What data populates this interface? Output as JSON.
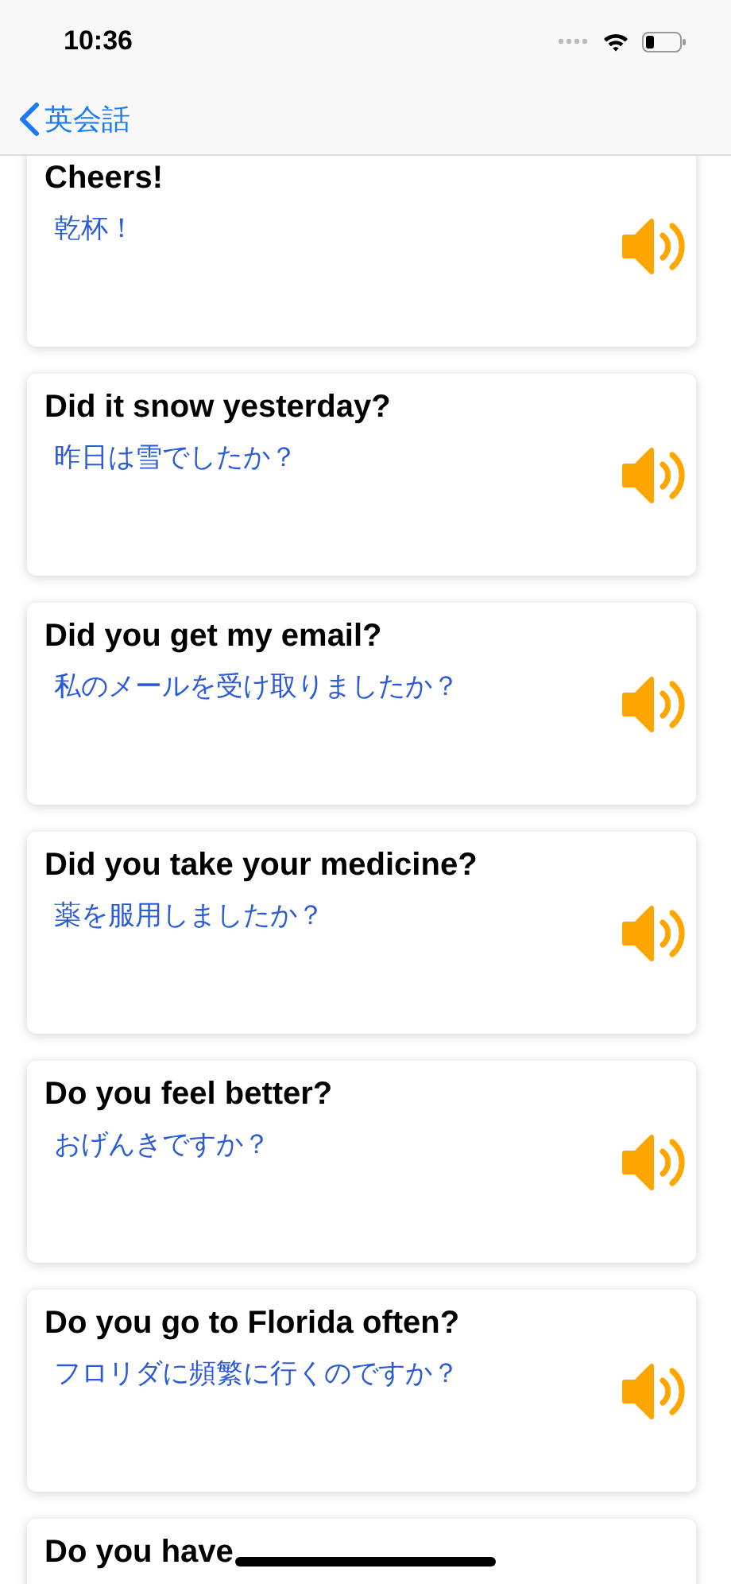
{
  "status_bar": {
    "time": "10:36"
  },
  "nav": {
    "back_label": "英会話"
  },
  "cards": [
    {
      "english": "Cheers!",
      "japanese": "乾杯！"
    },
    {
      "english": "Did it snow yesterday?",
      "japanese": "昨日は雪でしたか？"
    },
    {
      "english": "Did you get my email?",
      "japanese": "私のメールを受け取りましたか？"
    },
    {
      "english": "Did you take your medicine?",
      "japanese": "薬を服用しましたか？"
    },
    {
      "english": "Do you feel better?",
      "japanese": "おげんきですか？"
    },
    {
      "english": "Do you go to Florida often?",
      "japanese": "フロリダに頻繁に行くのですか？"
    },
    {
      "english": "Do you have"
    }
  ]
}
